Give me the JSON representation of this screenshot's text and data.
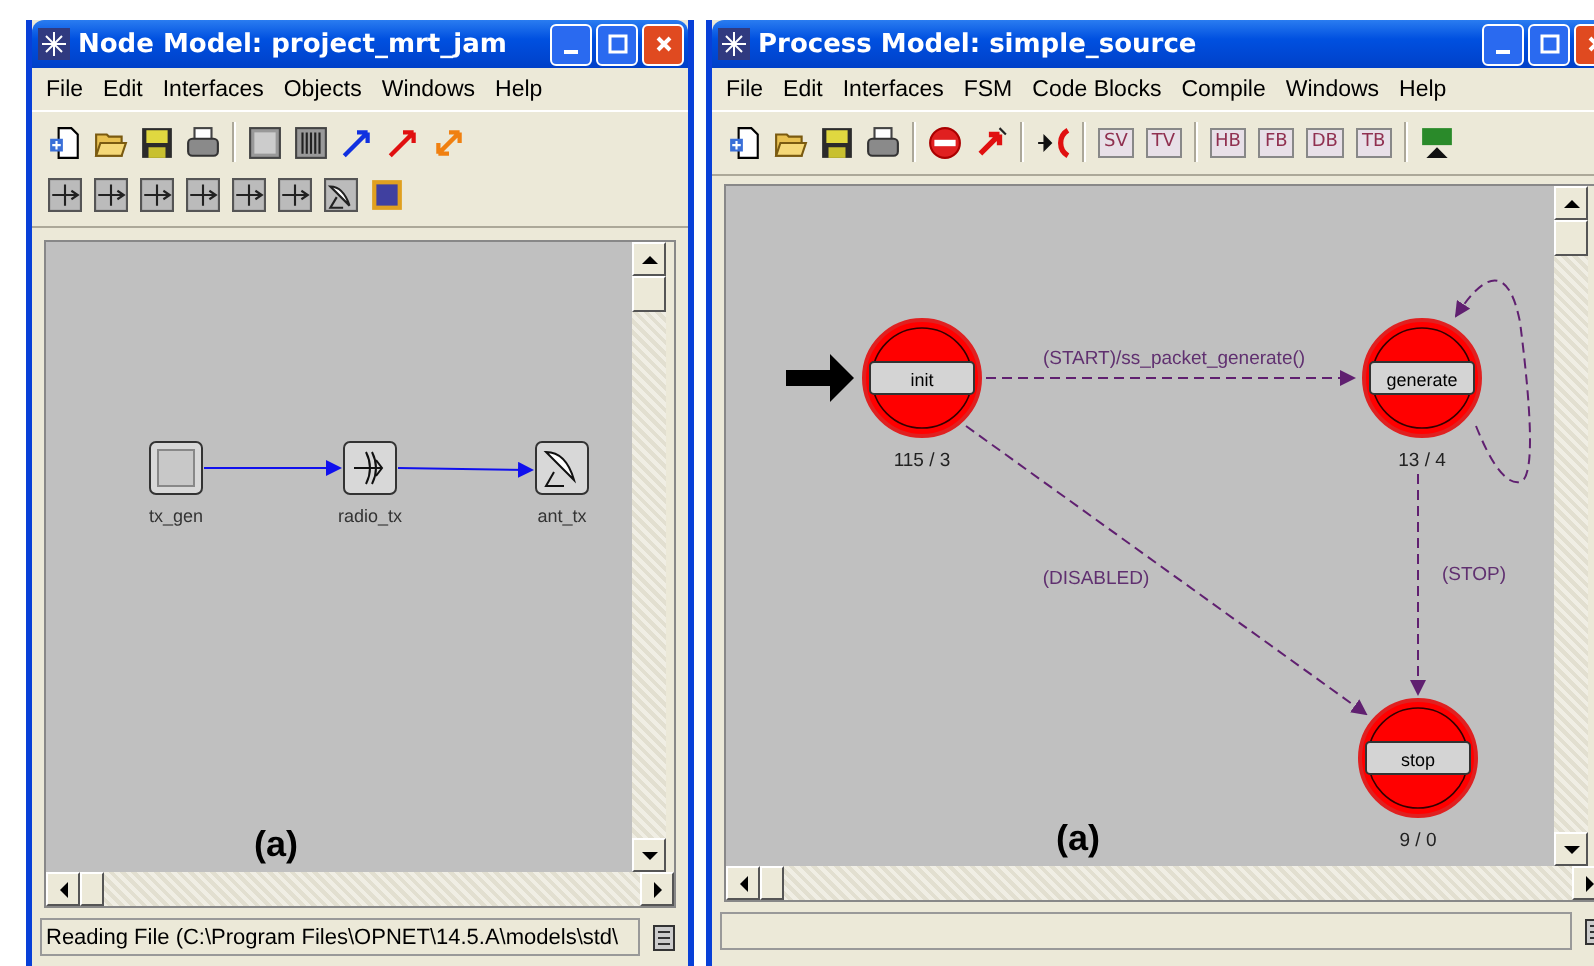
{
  "node_window": {
    "title": "Node Model: project_mrt_jam",
    "menu": [
      "File",
      "Edit",
      "Interfaces",
      "Objects",
      "Windows",
      "Help"
    ],
    "nodes": [
      {
        "label": "tx_gen",
        "kind": "generator"
      },
      {
        "label": "radio_tx",
        "kind": "transmitter"
      },
      {
        "label": "ant_tx",
        "kind": "antenna"
      }
    ],
    "caption": "(a)",
    "status": "Reading File (C:\\Program Files\\OPNET\\14.5.A\\models\\std\\"
  },
  "process_window": {
    "title": "Process Model: simple_source",
    "menu": [
      "File",
      "Edit",
      "Interfaces",
      "FSM",
      "Code Blocks",
      "Compile",
      "Windows",
      "Help"
    ],
    "code_buttons": [
      "SV",
      "TV",
      "HB",
      "FB",
      "DB",
      "TB"
    ],
    "states": [
      {
        "label": "init",
        "count": "115 / 3",
        "initial": true
      },
      {
        "label": "generate",
        "count": "13 / 4",
        "initial": false
      },
      {
        "label": "stop",
        "count": "9 / 0",
        "initial": false
      }
    ],
    "transitions": [
      {
        "label": "(START)/ss_packet_generate()"
      },
      {
        "label": "(DISABLED)"
      },
      {
        "label": "(STOP)"
      }
    ],
    "caption": "(a)"
  }
}
